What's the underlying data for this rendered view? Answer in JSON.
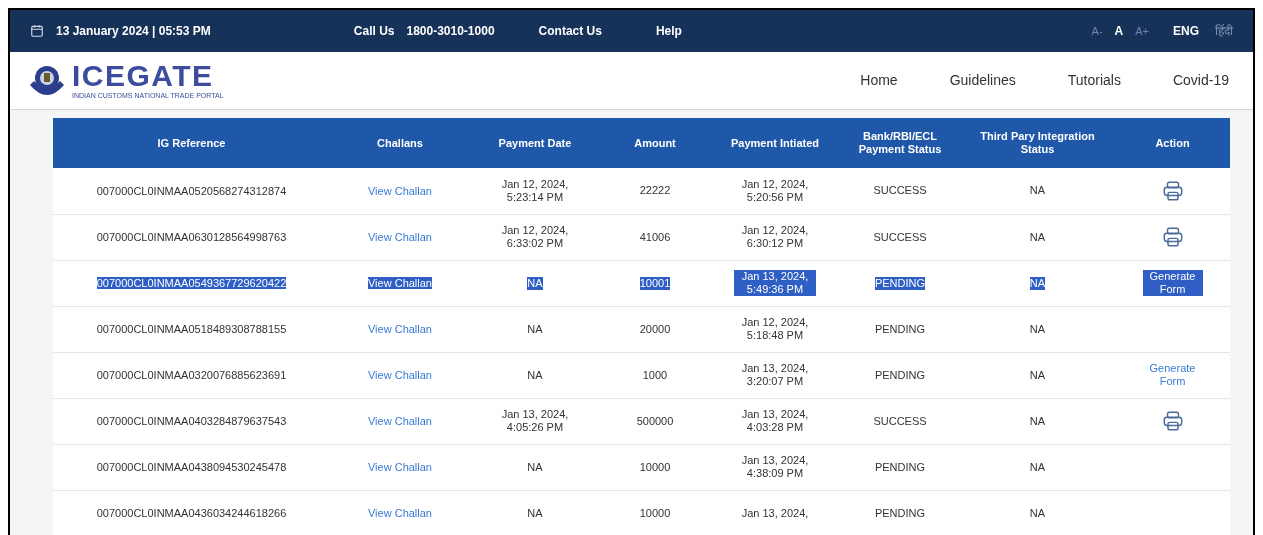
{
  "top_bar": {
    "datetime": "13 January 2024 | 05:53 PM",
    "call_label": "Call Us",
    "phone": "1800-3010-1000",
    "links": [
      "Contact Us",
      "Help"
    ],
    "font_sizes": [
      {
        "label": "A-",
        "selected": false
      },
      {
        "label": "A",
        "selected": true
      },
      {
        "label": "A+",
        "selected": false
      }
    ],
    "languages": [
      {
        "label": "ENG",
        "selected": true
      },
      {
        "label": "हिंदी",
        "selected": false
      }
    ]
  },
  "header": {
    "logo_text": "ICEGATE",
    "tagline": "INDIAN CUSTOMS NATIONAL TRADE PORTAL",
    "nav": [
      "Home",
      "Guidelines",
      "Tutorials",
      "Covid-19"
    ]
  },
  "table": {
    "columns": [
      "IG Reference",
      "Challans",
      "Payment Date",
      "Amount",
      "Payment Intiated",
      "Bank/RBI/ECL Payment Status",
      "Third Pary Integration Status",
      "Action"
    ],
    "rows": [
      {
        "selected": false,
        "ref": "007000CL0INMAA0520568274312874",
        "challan": "View Challan",
        "payment_date": "Jan 12, 2024, 5:23:14 PM",
        "amount": "22222",
        "initiated": "Jan 12, 2024, 5:20:56 PM",
        "bank_status": "SUCCESS",
        "third_party": "NA",
        "action": {
          "kind": "print"
        }
      },
      {
        "selected": false,
        "ref": "007000CL0INMAA0630128564998763",
        "challan": "View Challan",
        "payment_date": "Jan 12, 2024, 6:33:02 PM",
        "amount": "41006",
        "initiated": "Jan 12, 2024, 6:30:12 PM",
        "bank_status": "SUCCESS",
        "third_party": "NA",
        "action": {
          "kind": "print"
        }
      },
      {
        "selected": true,
        "ref": "007000CL0INMAA0549367729620422",
        "challan": "View Challan",
        "payment_date": "NA",
        "amount": "10001",
        "initiated": "Jan 13, 2024, 5:49:36 PM",
        "bank_status": "PENDING",
        "third_party": "NA",
        "action": {
          "kind": "generate",
          "label": "Generate Form"
        }
      },
      {
        "selected": false,
        "ref": "007000CL0INMAA0518489308788155",
        "challan": "View Challan",
        "payment_date": "NA",
        "amount": "20000",
        "initiated": "Jan 12, 2024, 5:18:48 PM",
        "bank_status": "PENDING",
        "third_party": "NA",
        "action": {
          "kind": "none"
        }
      },
      {
        "selected": false,
        "ref": "007000CL0INMAA0320076885623691",
        "challan": "View Challan",
        "payment_date": "NA",
        "amount": "1000",
        "initiated": "Jan 13, 2024, 3:20:07 PM",
        "bank_status": "PENDING",
        "third_party": "NA",
        "action": {
          "kind": "generate",
          "label": "Generate Form"
        }
      },
      {
        "selected": false,
        "ref": "007000CL0INMAA0403284879637543",
        "challan": "View Challan",
        "payment_date": "Jan 13, 2024, 4:05:26 PM",
        "amount": "500000",
        "initiated": "Jan 13, 2024, 4:03:28 PM",
        "bank_status": "SUCCESS",
        "third_party": "NA",
        "action": {
          "kind": "print"
        }
      },
      {
        "selected": false,
        "ref": "007000CL0INMAA0438094530245478",
        "challan": "View Challan",
        "payment_date": "NA",
        "amount": "10000",
        "initiated": "Jan 13, 2024, 4:38:09 PM",
        "bank_status": "PENDING",
        "third_party": "NA",
        "action": {
          "kind": "none"
        }
      },
      {
        "selected": false,
        "ref": "007000CL0INMAA0436034244618266",
        "challan": "View Challan",
        "payment_date": "NA",
        "amount": "10000",
        "initiated": "Jan 13, 2024,",
        "bank_status": "PENDING",
        "third_party": "NA",
        "action": {
          "kind": "none"
        }
      }
    ]
  }
}
